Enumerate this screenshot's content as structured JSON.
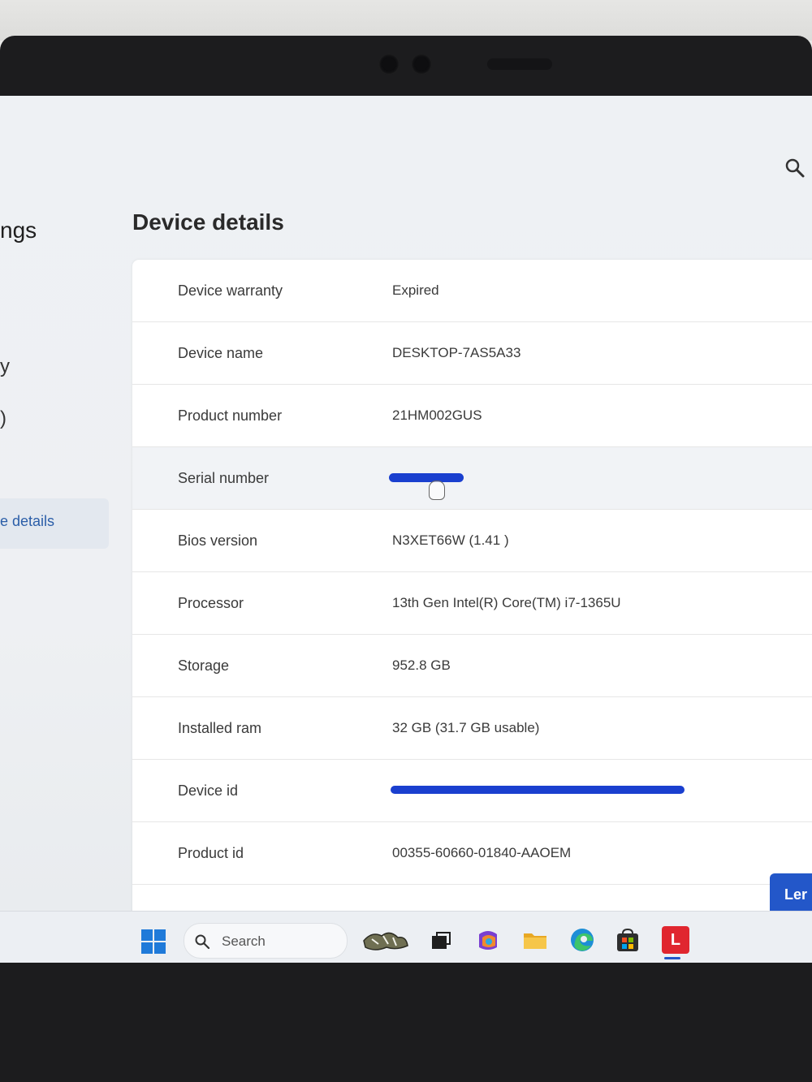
{
  "sidebar": {
    "title_fragment": "ngs",
    "fragment_1": "y",
    "fragment_2": ")",
    "active_item_fragment": "e details"
  },
  "page_title": "Device details",
  "details": [
    {
      "label": "Device warranty",
      "value": "Expired"
    },
    {
      "label": "Device name",
      "value": "DESKTOP-7AS5A33"
    },
    {
      "label": "Product number",
      "value": "21HM002GUS"
    },
    {
      "label": "Serial number",
      "value": ""
    },
    {
      "label": "Bios version",
      "value": "N3XET66W (1.41 )"
    },
    {
      "label": "Processor",
      "value": "13th Gen Intel(R) Core(TM) i7-1365U"
    },
    {
      "label": "Storage",
      "value": "952.8 GB"
    },
    {
      "label": "Installed ram",
      "value": "32 GB (31.7 GB usable)"
    },
    {
      "label": "Device id",
      "value": ""
    },
    {
      "label": "Product id",
      "value": "00355-60660-01840-AAOEM"
    }
  ],
  "learn_button_fragment": "Ler",
  "taskbar": {
    "search_placeholder": "Search",
    "pinned_app_letter": "L",
    "icons": [
      "windows-start-icon",
      "search-icon",
      "widgets-icon",
      "task-view-icon",
      "copilot-icon",
      "file-explorer-icon",
      "edge-icon",
      "store-icon",
      "lenovo-vantage-icon"
    ]
  },
  "colors": {
    "accent": "#2357c9",
    "redaction": "#1a3fcf"
  }
}
